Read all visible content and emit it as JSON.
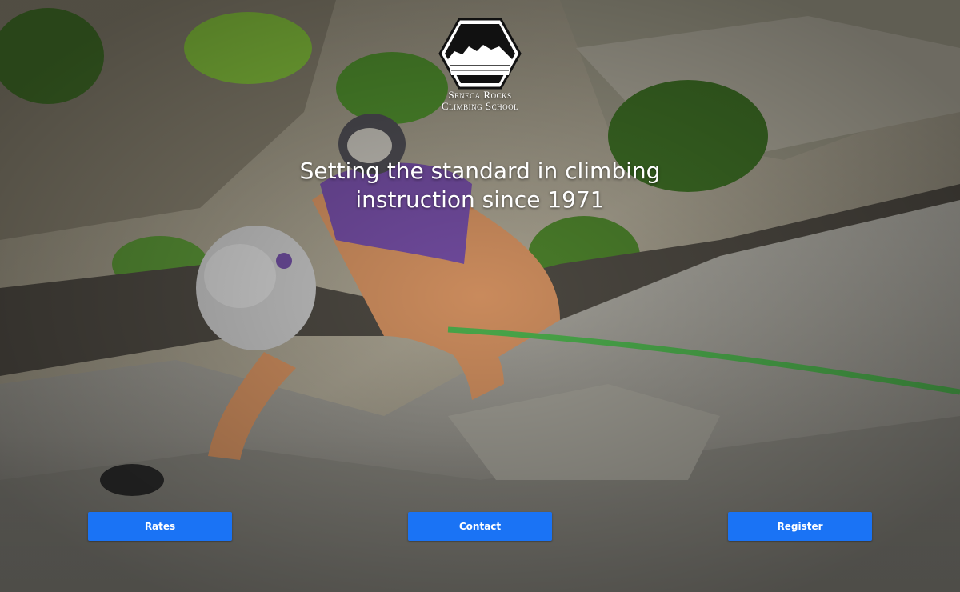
{
  "logo": {
    "icon": "mountain-hexagon-icon",
    "line1": "Seneca Rocks",
    "line2": "Climbing School"
  },
  "hero": {
    "image": "photo of a climber on a granite rock face",
    "tagline_line1": "Setting the standard in climbing",
    "tagline_line2": "instruction since 1971"
  },
  "nav": {
    "rates_label": "Rates",
    "contact_label": "Contact",
    "register_label": "Register"
  },
  "colors": {
    "button": "#1a73f5",
    "button_text": "#ffffff",
    "rope": "#4aa84a"
  }
}
